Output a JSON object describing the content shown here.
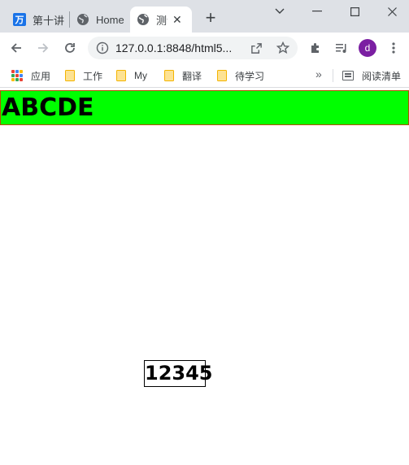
{
  "browser": {
    "tabs": [
      {
        "title": "第十讲",
        "favicon_text": "万",
        "active": false
      },
      {
        "title": "Home",
        "active": false
      },
      {
        "title": "测试",
        "active": true
      }
    ],
    "new_tab_glyph": "+",
    "address": "127.0.0.1:8848/html5...",
    "profile_initial": "d",
    "colors": {
      "accent": "#1a73e8",
      "profile": "#7b1fa2"
    }
  },
  "bookmarks": {
    "items": [
      {
        "label": "应用",
        "icon": "apps-grid-icon"
      },
      {
        "label": "工作",
        "icon": "folder-icon"
      },
      {
        "label": "My",
        "icon": "folder-icon"
      },
      {
        "label": "翻译",
        "icon": "folder-icon"
      },
      {
        "label": "待学习",
        "icon": "folder-icon"
      }
    ],
    "overflow_glyph": "»",
    "reading_list_label": "阅读清单"
  },
  "page": {
    "banner_text": "ABCDE",
    "box_text": "12345",
    "colors": {
      "banner_bg": "#00ff00",
      "banner_border": "#b84a00",
      "box_border": "#000000"
    }
  }
}
